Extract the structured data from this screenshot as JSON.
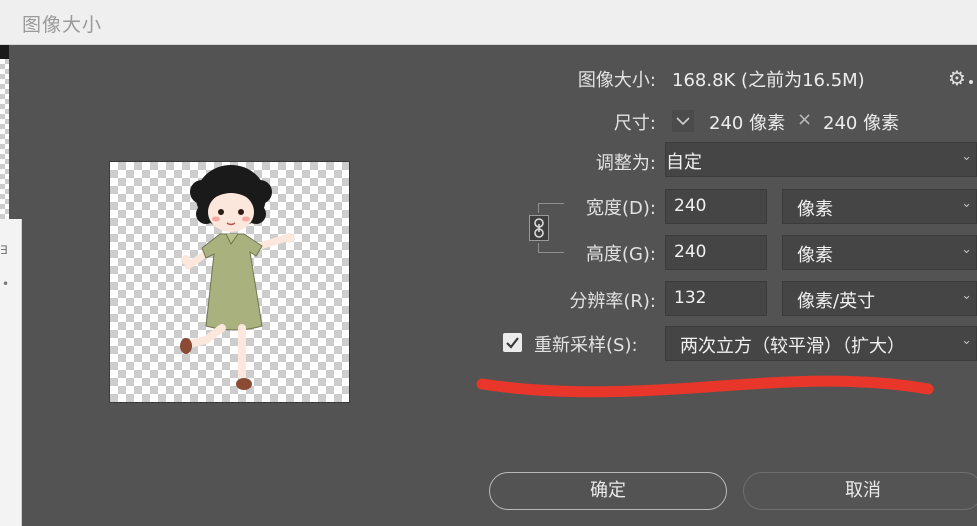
{
  "window": {
    "title": "图像大小"
  },
  "info": {
    "image_size_label": "图像大小:",
    "image_size_value": "168.8K (之前为16.5M)",
    "dimensions_label": "尺寸:",
    "width_value": "240 像素",
    "times": "×",
    "height_value": "240 像素"
  },
  "fit_to": {
    "label": "调整为:",
    "value": "自定"
  },
  "width": {
    "label": "宽度(D):",
    "value": "240",
    "unit": "像素"
  },
  "height": {
    "label": "高度(G):",
    "value": "240",
    "unit": "像素"
  },
  "resolution": {
    "label": "分辨率(R):",
    "value": "132",
    "unit": "像素/英寸"
  },
  "resample": {
    "label": "重新采样(S):",
    "checked": true,
    "value": "两次立方（较平滑）（扩大）"
  },
  "buttons": {
    "ok": "确定",
    "cancel": "取消"
  },
  "icons": {
    "gear": "gear-icon",
    "link": "link-icon",
    "chevron": "chevron-down-icon",
    "check": "checkmark-icon"
  },
  "colors": {
    "dialog_bg": "#535353",
    "field_bg": "#454545",
    "annotation_red": "#e8372a"
  }
}
